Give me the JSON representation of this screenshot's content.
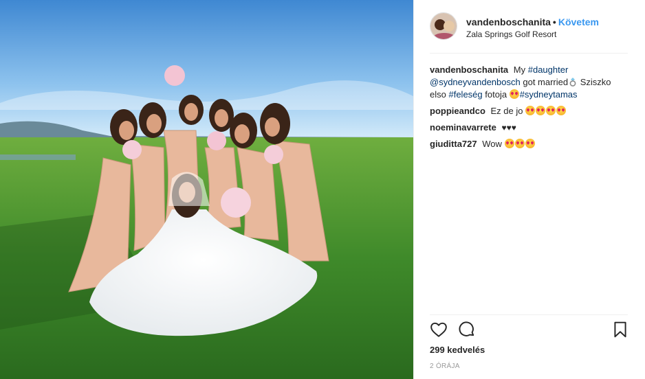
{
  "post": {
    "author": "vandenboschanita",
    "separator": "•",
    "follow_label": "Követem",
    "location": "Zala Springs Golf Resort"
  },
  "caption": {
    "user": "vandenboschanita",
    "text_1": "My",
    "tag_1": "#daughter",
    "mention": "@sydneyvandenbosch",
    "text_2": "got married",
    "text_3": "Sziszko elso",
    "tag_2": "#feleség",
    "text_4": "fotoja",
    "tag_3": "#sydneytamas"
  },
  "comments": [
    {
      "user": "poppieandco",
      "text": "Ez de jo"
    },
    {
      "user": "noeminavarrete",
      "text": "♥♥♥"
    },
    {
      "user": "giuditta727",
      "text": "Wow"
    }
  ],
  "icons": {
    "like": "heart-icon",
    "comment": "comment-icon",
    "save": "bookmark-icon",
    "emoji": "heart-eyes-emoji",
    "ring": "ring-emoji"
  },
  "likes": "299 kedvelés",
  "timestamp": "2 ÓRÁJA",
  "colors": {
    "link": "#003569",
    "follow": "#3897f0",
    "text": "#262626",
    "muted": "#999999"
  }
}
